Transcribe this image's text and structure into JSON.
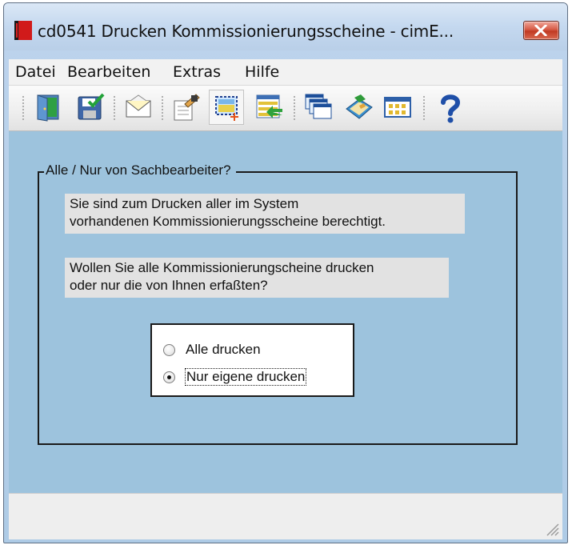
{
  "window": {
    "title": "cd0541 Drucken Kommissionierungsscheine - cimE..."
  },
  "menu": {
    "items": [
      "Datei",
      "Bearbeiten",
      "Extras",
      "Hilfe"
    ]
  },
  "toolbar": {
    "buttons": [
      "exit-door-icon",
      "save-check-icon",
      "envelope-icon",
      "edit-form-icon",
      "select-region-icon",
      "list-arrow-icon",
      "windows-stack-icon",
      "book-icon",
      "grid-icon",
      "help-icon"
    ]
  },
  "group": {
    "legend": "Alle / Nur von Sachbearbeiter?",
    "info1_line1": "Sie sind zum Drucken aller im System",
    "info1_line2": "vorhandenen Kommissionierungsscheine berechtigt.",
    "info2_line1": "Wollen Sie alle Kommissionierungscheine drucken",
    "info2_line2": "oder nur die von Ihnen erfaßten?"
  },
  "options": {
    "all_label": "Alle drucken",
    "own_label": "Nur eigene drucken",
    "selected": "own"
  },
  "colors": {
    "content_bg": "#9dc3dd",
    "close_button": "#c13a22"
  }
}
